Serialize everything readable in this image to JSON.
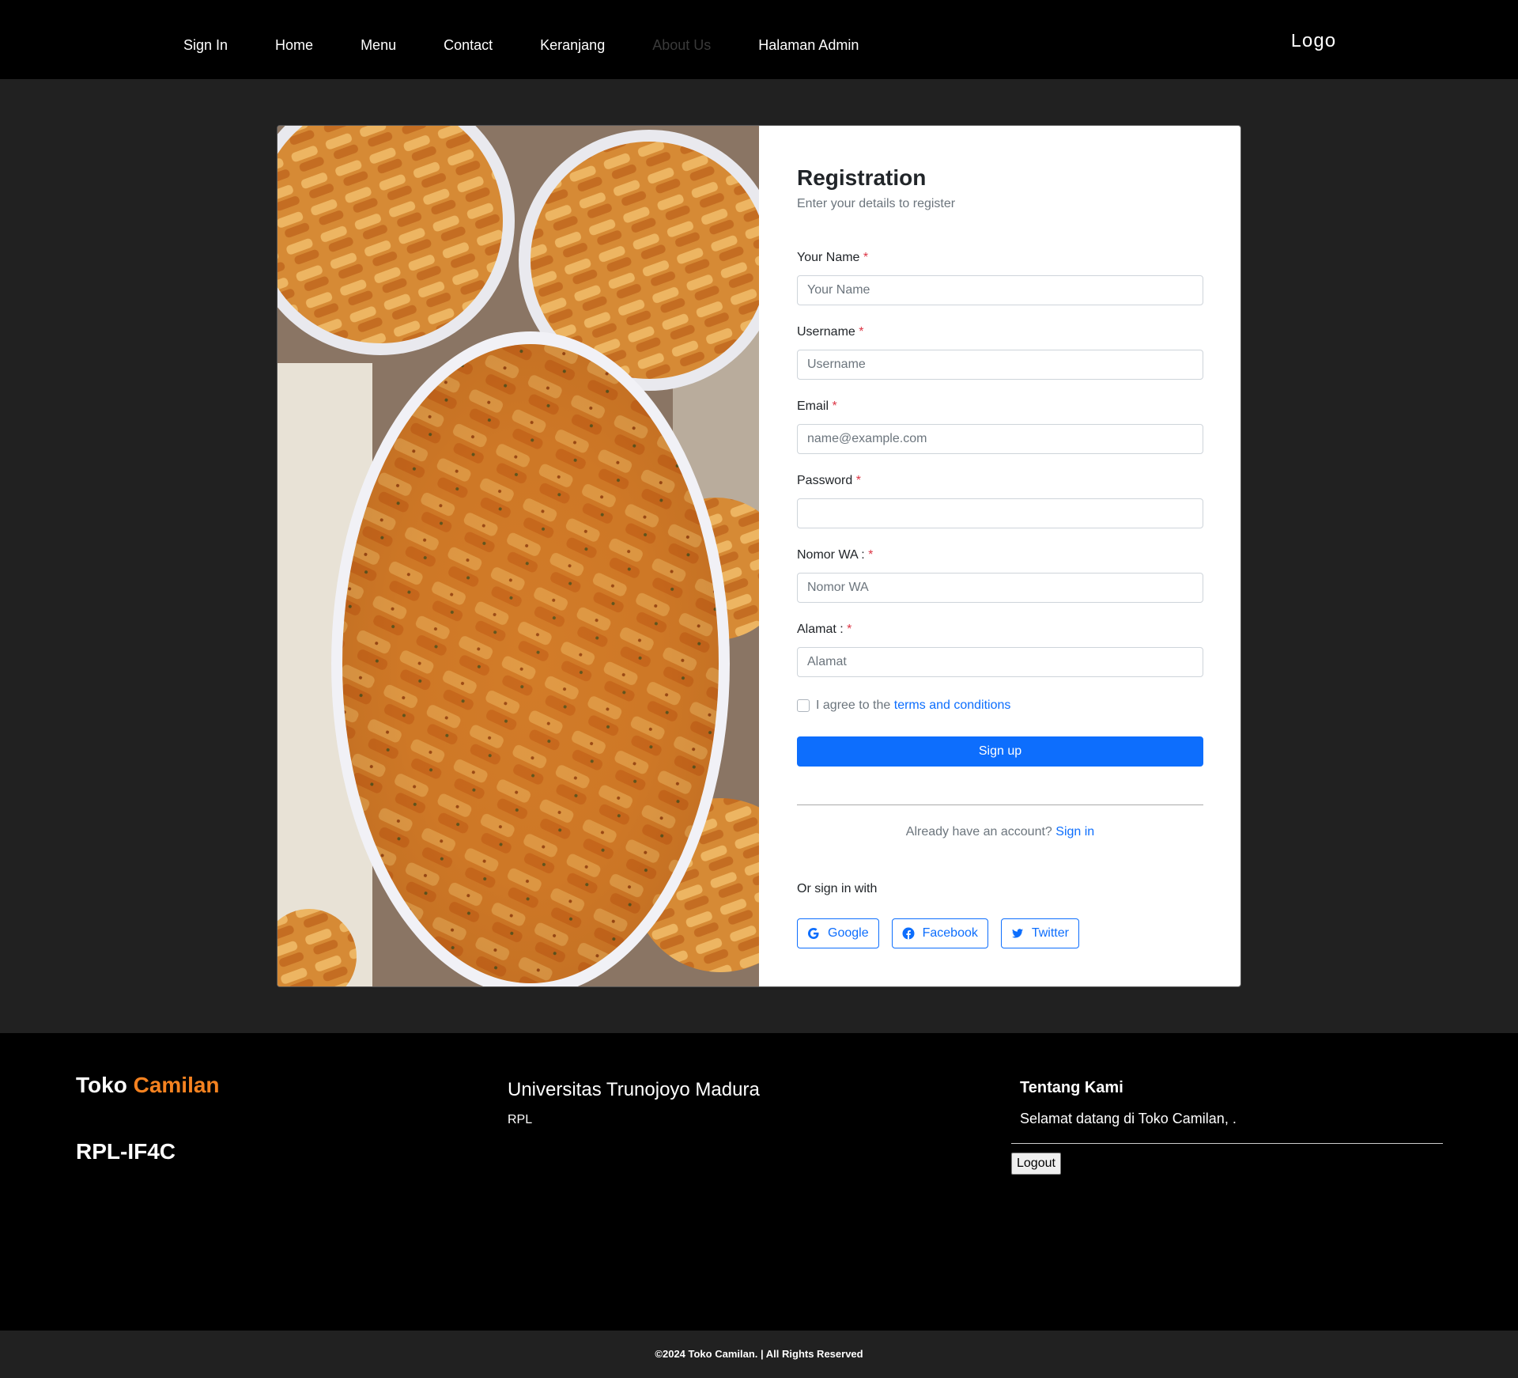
{
  "nav": {
    "items": [
      {
        "label": "Sign In"
      },
      {
        "label": "Home"
      },
      {
        "label": "Menu"
      },
      {
        "label": "Contact"
      },
      {
        "label": "Keranjang"
      },
      {
        "label": "About Us"
      },
      {
        "label": "Halaman Admin"
      }
    ],
    "logo": "Logo"
  },
  "form": {
    "title": "Registration",
    "subtitle": "Enter your details to register",
    "required_mark": "*",
    "fields": [
      {
        "label": "Your Name",
        "placeholder": "Your Name",
        "value": ""
      },
      {
        "label": "Username",
        "placeholder": "Username",
        "value": ""
      },
      {
        "label": "Email",
        "placeholder": "name@example.com",
        "value": ""
      },
      {
        "label": "Password",
        "placeholder": "",
        "value": ""
      },
      {
        "label": "Nomor WA :",
        "placeholder": "Nomor WA",
        "value": ""
      },
      {
        "label": "Alamat :",
        "placeholder": "Alamat",
        "value": ""
      }
    ],
    "agree_text": "I agree to the",
    "terms_link": "terms and conditions",
    "signup_button": "Sign up",
    "already_text": "Already have an account?",
    "signin_link": "Sign in",
    "or_sign_in": "Or sign in with",
    "social": [
      {
        "label": "Google",
        "icon": "google-icon"
      },
      {
        "label": "Facebook",
        "icon": "facebook-icon"
      },
      {
        "label": "Twitter",
        "icon": "twitter-icon"
      }
    ]
  },
  "footer": {
    "brand_part1": "Toko",
    "brand_part2": "Camilan",
    "class_name": "RPL-IF4C",
    "university": "Universitas Trunojoyo Madura",
    "university_sub": "RPL",
    "about_title": "Tentang Kami",
    "about_text": "Selamat datang di Toko Camilan, .",
    "logout_button": "Logout",
    "copyright": "©2024 Toko Camilan. | All Rights Reserved"
  },
  "colors": {
    "primary": "#0d6efd",
    "brand_accent": "#f58220",
    "background": "#212121",
    "navbar": "#000000"
  }
}
